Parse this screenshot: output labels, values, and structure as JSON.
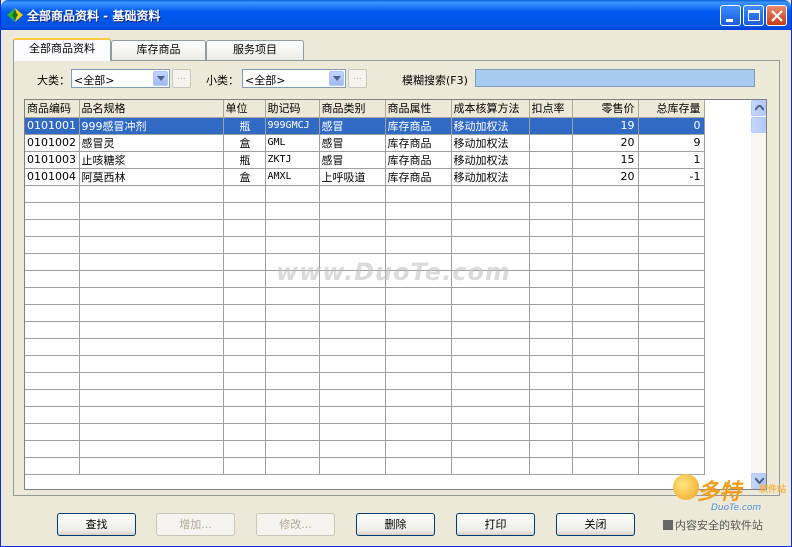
{
  "window": {
    "title": "全部商品资料 - 基础资料"
  },
  "tabs": [
    {
      "label": "全部商品资料",
      "active": true
    },
    {
      "label": "库存商品",
      "active": false
    },
    {
      "label": "服务项目",
      "active": false
    }
  ],
  "filters": {
    "category_label": "大类：",
    "category_value": "<全部>",
    "subcategory_label": "小类：",
    "subcategory_value": "<全部>",
    "search_label": "模糊搜索(F3)",
    "search_value": "",
    "dots_label": "..."
  },
  "grid": {
    "columns": [
      "商品编码",
      "品名规格",
      "单位",
      "助记码",
      "商品类别",
      "商品属性",
      "成本核算方法",
      "扣点率",
      "零售价",
      "总库存量"
    ],
    "rows": [
      [
        "0101001",
        "999感冒冲剂",
        "瓶",
        "999GMCJ",
        "感冒",
        "库存商品",
        "移动加权法",
        "",
        "19",
        "0"
      ],
      [
        "0101002",
        "感冒灵",
        "盒",
        "GML",
        "感冒",
        "库存商品",
        "移动加权法",
        "",
        "20",
        "9"
      ],
      [
        "0101003",
        "止咳糖浆",
        "瓶",
        "ZKTJ",
        "感冒",
        "库存商品",
        "移动加权法",
        "",
        "15",
        "1"
      ],
      [
        "0101004",
        "阿莫西林",
        "盒",
        "AMXL",
        "上呼吸道",
        "库存商品",
        "移动加权法",
        "",
        "20",
        "-1"
      ]
    ],
    "selected_row": 0,
    "empty_rows": 17
  },
  "buttons": {
    "find": "查找",
    "add": "增加...",
    "edit": "修改...",
    "delete": "删除",
    "print": "打印",
    "close": "关闭"
  },
  "watermark": "www.DuoTe.com",
  "brand": {
    "big": "多特",
    "small": "软件站",
    "url": "DuoTe.com",
    "tagline": "内容安全的软件站"
  },
  "colors": {
    "titlebar": "#0054e3",
    "selection": "#316ac5",
    "search_box": "#a6caf0",
    "panel_bg": "#ece9d8"
  }
}
